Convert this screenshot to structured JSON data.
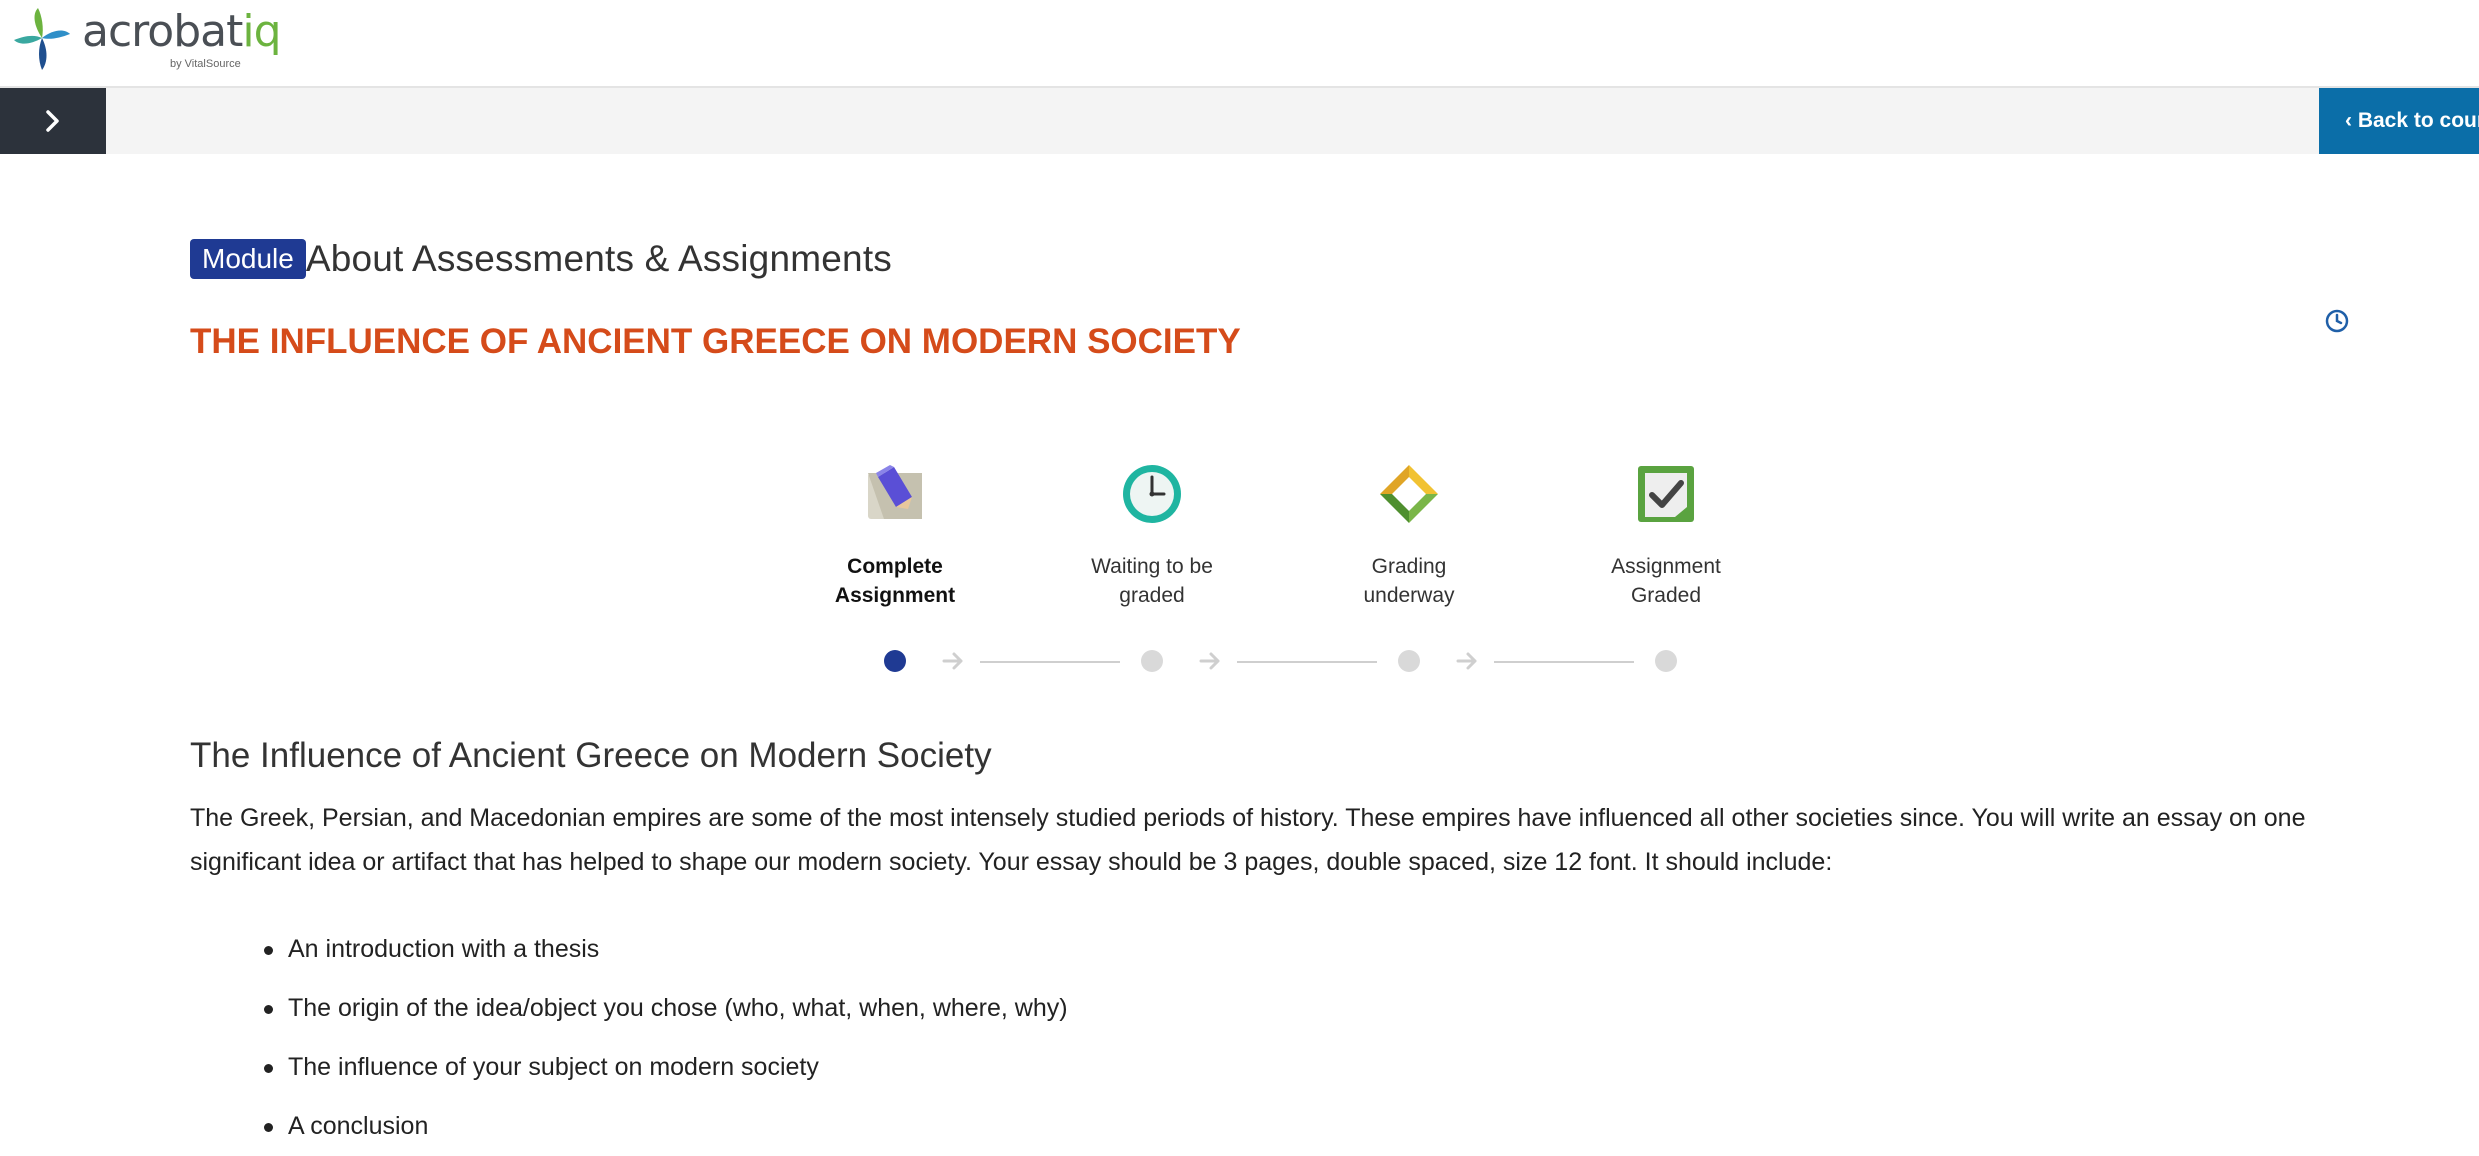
{
  "header": {
    "logo_word_main": "acrobat",
    "logo_word_accent": "iq",
    "logo_sub": "by VitalSource"
  },
  "toolbar": {
    "back_label": "‹ Back to course"
  },
  "module": {
    "badge": "Module",
    "title": "About Assessments & Assignments"
  },
  "assignment": {
    "title": "THE INFLUENCE OF ANCIENT GREECE ON MODERN SOCIETY"
  },
  "progress": {
    "current_step": 1,
    "steps": [
      {
        "label_line1": "Complete",
        "label_line2": "Assignment",
        "icon": "pencil-icon"
      },
      {
        "label_line1": "Waiting to be",
        "label_line2": "graded",
        "icon": "clock-icon"
      },
      {
        "label_line1": "Grading",
        "label_line2": "underway",
        "icon": "refresh-arrows-icon"
      },
      {
        "label_line1": "Assignment",
        "label_line2": "Graded",
        "icon": "checkmark-icon"
      }
    ]
  },
  "content": {
    "heading": "The Influence of Ancient Greece on Modern Society",
    "paragraph": "The Greek, Persian, and Macedonian empires are some of the most intensely studied periods of history. These empires have influenced all other societies since. You will write an essay on one significant idea or artifact that has helped to shape our modern society. Your essay should be 3 pages, double spaced, size 12 font. It should include:",
    "bullets": [
      "An introduction with a thesis",
      "The origin of the idea/object you chose (who, what, when, where, why)",
      "The influence of your subject on modern society",
      "A conclusion"
    ]
  },
  "colors": {
    "accent_blue": "#1f3a93",
    "title_orange": "#d54b1a",
    "back_button": "#0b6ea8",
    "toggle_dark": "#2c323b",
    "logo_green": "#6cb33f"
  }
}
